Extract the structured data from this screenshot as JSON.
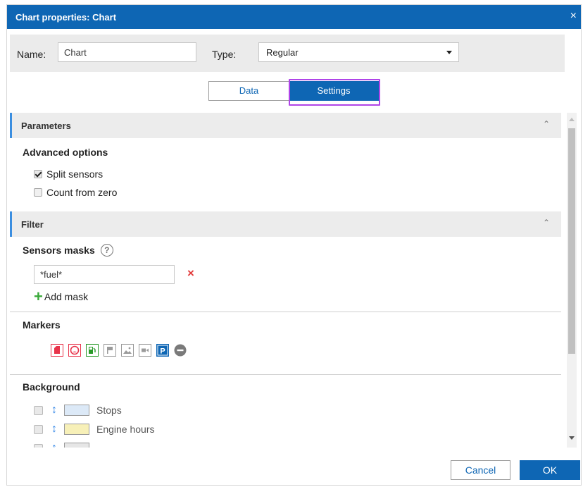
{
  "dialog": {
    "title": "Chart properties: Chart",
    "close_glyph": "×"
  },
  "form": {
    "name_label": "Name:",
    "name_value": "Chart",
    "type_label": "Type:",
    "type_value": "Regular"
  },
  "tabs": [
    {
      "label": "Data",
      "active": false
    },
    {
      "label": "Settings",
      "active": true
    }
  ],
  "parameters": {
    "section_title": "Parameters",
    "group_title": "Advanced options",
    "options": [
      {
        "label": "Split sensors",
        "checked": true
      },
      {
        "label": "Count from zero",
        "checked": false
      }
    ]
  },
  "filter": {
    "section_title": "Filter",
    "sensors_masks_title": "Sensors masks",
    "help_glyph": "?",
    "mask_value": "*fuel*",
    "delete_glyph": "×",
    "add_mask_glyph": "+",
    "add_mask_label": "Add mask"
  },
  "markers": {
    "title": "Markers",
    "items": [
      {
        "icon": "fuel-can-icon",
        "color": "#e8334a"
      },
      {
        "icon": "gauge-icon",
        "color": "#e8334a"
      },
      {
        "icon": "fuel-station-icon",
        "color": "#2a9a2a"
      },
      {
        "icon": "flag-icon",
        "color": "#9a9a9a"
      },
      {
        "icon": "image-icon",
        "color": "#9a9a9a"
      },
      {
        "icon": "video-camera-icon",
        "color": "#9a9a9a"
      },
      {
        "icon": "parking-icon",
        "color": "#0e66b4"
      },
      {
        "icon": "minus-circle-icon",
        "color": "#7a7a7a"
      }
    ]
  },
  "background": {
    "title": "Background",
    "items": [
      {
        "label": "Stops",
        "color": "#dce9f7"
      },
      {
        "label": "Engine hours",
        "color": "#f7f0b8"
      },
      {
        "label": "",
        "color": "#e6e6e6"
      }
    ]
  },
  "buttons": {
    "cancel": "Cancel",
    "ok": "OK"
  },
  "colors": {
    "accent": "#0e66b4",
    "tab_highlight": "#b044e8",
    "section_marker": "#3b8ee0"
  }
}
